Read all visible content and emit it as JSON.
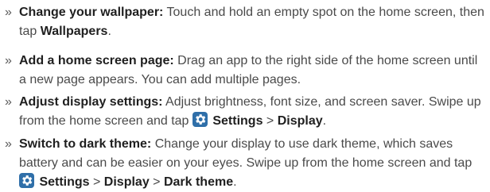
{
  "items": [
    {
      "bullet": "»",
      "title": "Change your wallpaper:",
      "text": " Touch and hold an empty spot on the home screen, then tap ",
      "strong_1": "Wallpapers",
      "end": "."
    },
    {
      "bullet": "»",
      "title": "Add a home screen page:",
      "text": " Drag an app to the right side of the home screen until a new page appears. You can add multiple pages."
    },
    {
      "bullet": "»",
      "title": "Adjust display settings:",
      "text": " Adjust brightness, font size, and screen saver. Swipe up from the home screen and tap ",
      "icon": "settings-gear-icon",
      "strong_1": " Settings",
      "sep_1": " > ",
      "strong_2": "Display",
      "end": "."
    },
    {
      "bullet": "»",
      "title": "Switch to dark theme:",
      "text": " Change your display to use dark theme, which saves battery and can be easier on your eyes. Swipe up from the home screen and tap ",
      "icon": "settings-gear-icon",
      "strong_1": " Settings",
      "sep_1": " > ",
      "strong_2": "Display",
      "sep_2": " > ",
      "strong_3": "Dark theme",
      "end": "."
    }
  ],
  "colors": {
    "text": "#4a4a4a",
    "bold": "#1f1f1f",
    "icon_bg": "#2f6fa9"
  }
}
